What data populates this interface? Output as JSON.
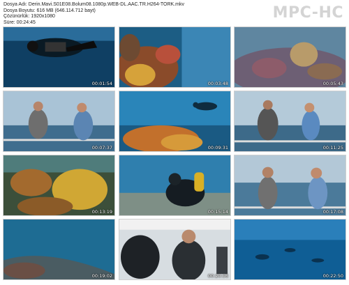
{
  "file_info": {
    "filename": "Dosya Adı: Derin.Mavi.S01E08.Bolum08.1080p.WEB-DL.AAC.TR.H264-TORK.mkv",
    "size": "Dosya Boyutu: 616 MB (646.114.712 bayt)",
    "resolution": "Çözünürlük: 1920x1080",
    "duration": "Süre: 00:24:45"
  },
  "logo": "MPC-HC",
  "thumbnails": [
    {
      "time": "00:01:54",
      "scene": "diver-dark",
      "icon": "diver-silhouette"
    },
    {
      "time": "00:03:48",
      "scene": "coral-reef",
      "icon": "orange-coral"
    },
    {
      "time": "00:05:43",
      "scene": "reef-wide",
      "icon": "purple-reef"
    },
    {
      "time": "00:07:37",
      "scene": "boat-two-men",
      "icon": "two-men-on-deck"
    },
    {
      "time": "00:09:31",
      "scene": "diver-over-coral",
      "icon": "diver-above-coral"
    },
    {
      "time": "00:11:25",
      "scene": "boat-two-men-talking",
      "icon": "two-men-gesturing"
    },
    {
      "time": "00:13:19",
      "scene": "yellow-coral",
      "icon": "yellow-gorgonian"
    },
    {
      "time": "00:15:14",
      "scene": "diver-close",
      "icon": "diver-with-tank"
    },
    {
      "time": "00:17:08",
      "scene": "boat-men-sea",
      "icon": "men-facing-sea"
    },
    {
      "time": "00:19:02",
      "scene": "deep-blue-slope",
      "icon": "reef-slope"
    },
    {
      "time": "00:20:56",
      "scene": "divers-in-boat",
      "icon": "divers-on-boat"
    },
    {
      "time": "00:22:50",
      "scene": "divers-deep-blue",
      "icon": "distant-divers"
    }
  ]
}
